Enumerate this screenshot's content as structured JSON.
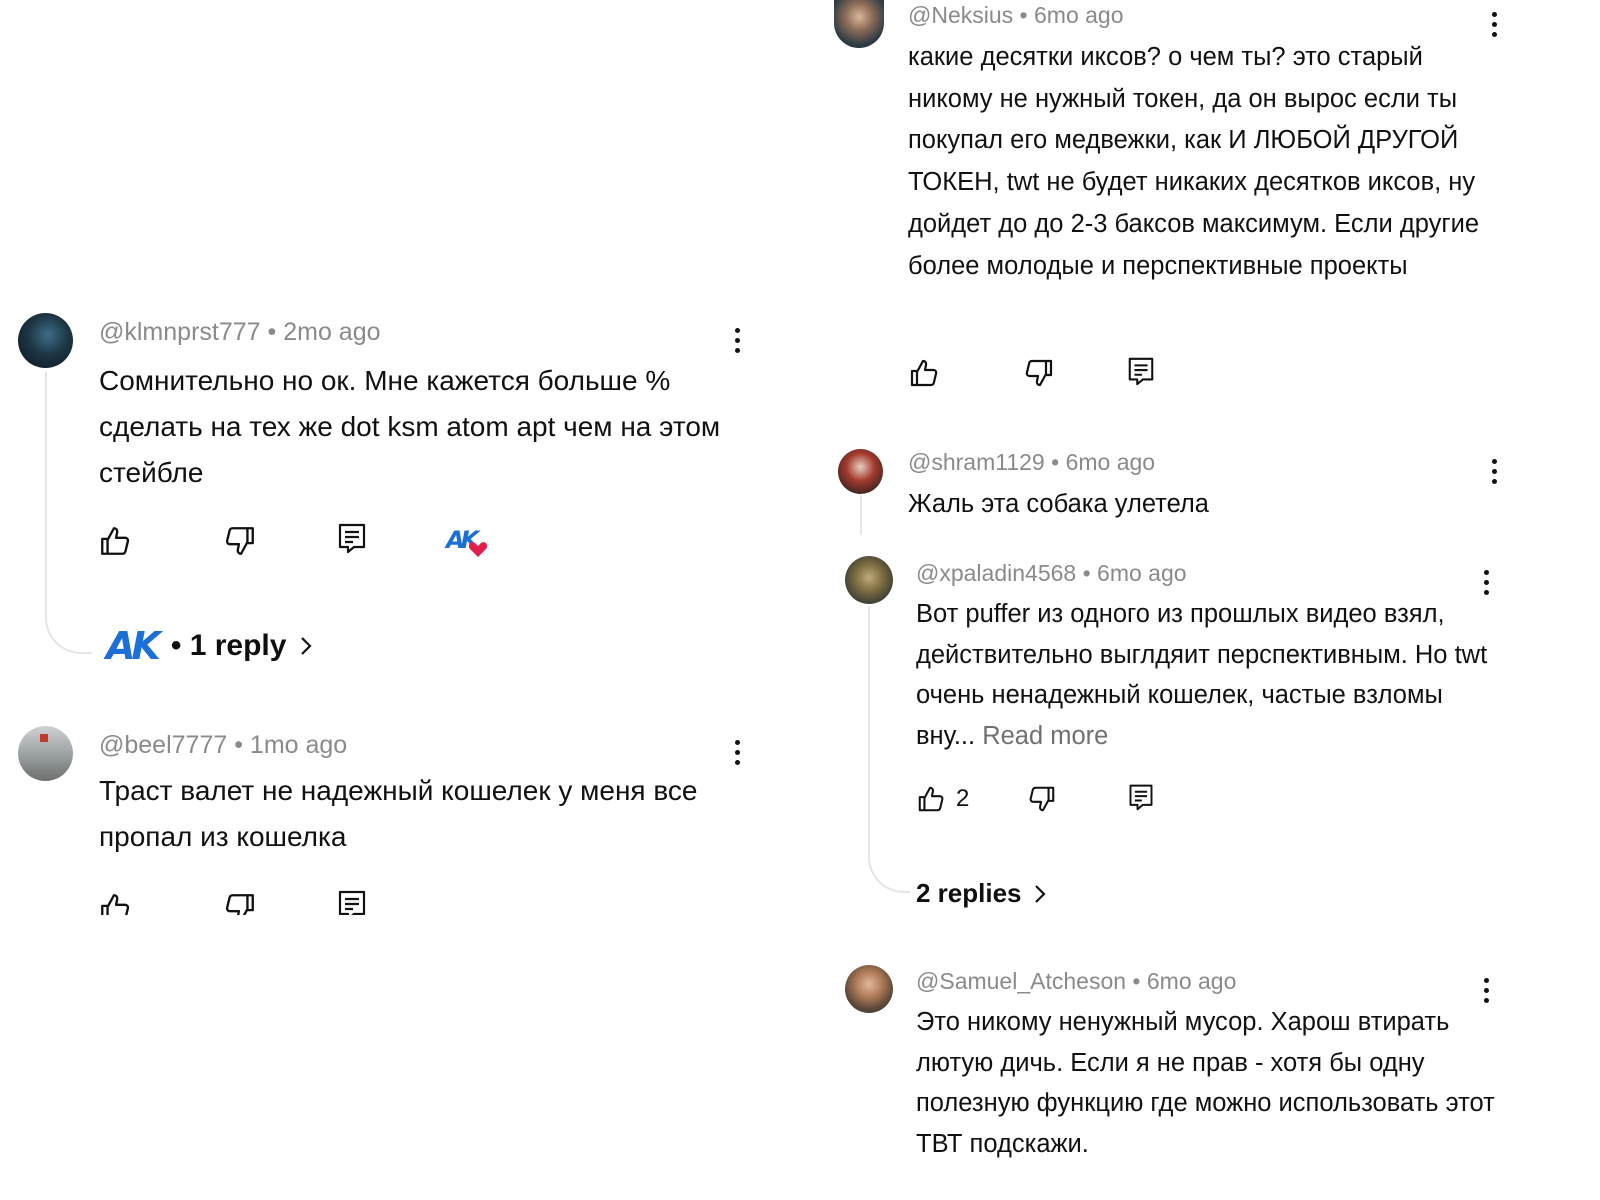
{
  "colors": {
    "meta": "#8a8a8a",
    "text": "#111111",
    "thread_line": "#e5e5e5",
    "heart": "#e0204a",
    "logo_blue": "#1b6fd6"
  },
  "comments": {
    "klmnprst": {
      "handle": "@klmnprst777",
      "time": "2mo ago",
      "text": "Сомнительно но ок. Мне кажется больше % сделать на тех же dot ksm atom apt чем на этом стейбле",
      "creator_badge": "AK",
      "reply_avatar": "AK",
      "replies_label": "• 1 reply"
    },
    "beel": {
      "handle": "@beel7777",
      "time": "1mo ago",
      "text": "Траст валет не надежный кошелек у меня все пропал из кошелка"
    },
    "neksius": {
      "handle": "@Neksius",
      "time": "6mo ago",
      "text": "какие десятки иксов? о  чем ты? это старый никому не нужный токен, да он вырос если ты покупал его  медвежки, как И ЛЮБОЙ ДРУГОЙ ТОКЕН,  twt  не будет никаких десятков иксов, ну дойдет до до 2-3 баксов максимум. Если другие более молодые и перспективные проекты"
    },
    "shram": {
      "handle": "@shram1129",
      "time": "6mo ago",
      "text": "Жаль эта собака улетела"
    },
    "xpaladin": {
      "handle": "@xpaladin4568",
      "time": "6mo ago",
      "text": "Вот puffer из одного из прошлых видео взял, действительно выглдяит перспективным. Но twt очень ненадежный кошелек, частые взломы вну...",
      "read_more": "Read more",
      "likes": "2",
      "replies_label": "2 replies"
    },
    "samuel": {
      "handle": "@Samuel_Atcheson",
      "time": "6mo ago",
      "text": "Это никому ненужный мусор. Харош втирать лютую дичь. Если я не прав - хотя бы одну полезную функцию где можно использовать этот ТВТ подскажи."
    }
  },
  "separator": " • ",
  "icons": [
    "like-icon",
    "dislike-icon",
    "reply-icon",
    "more-icon",
    "heart-icon",
    "chevron-right-icon"
  ]
}
